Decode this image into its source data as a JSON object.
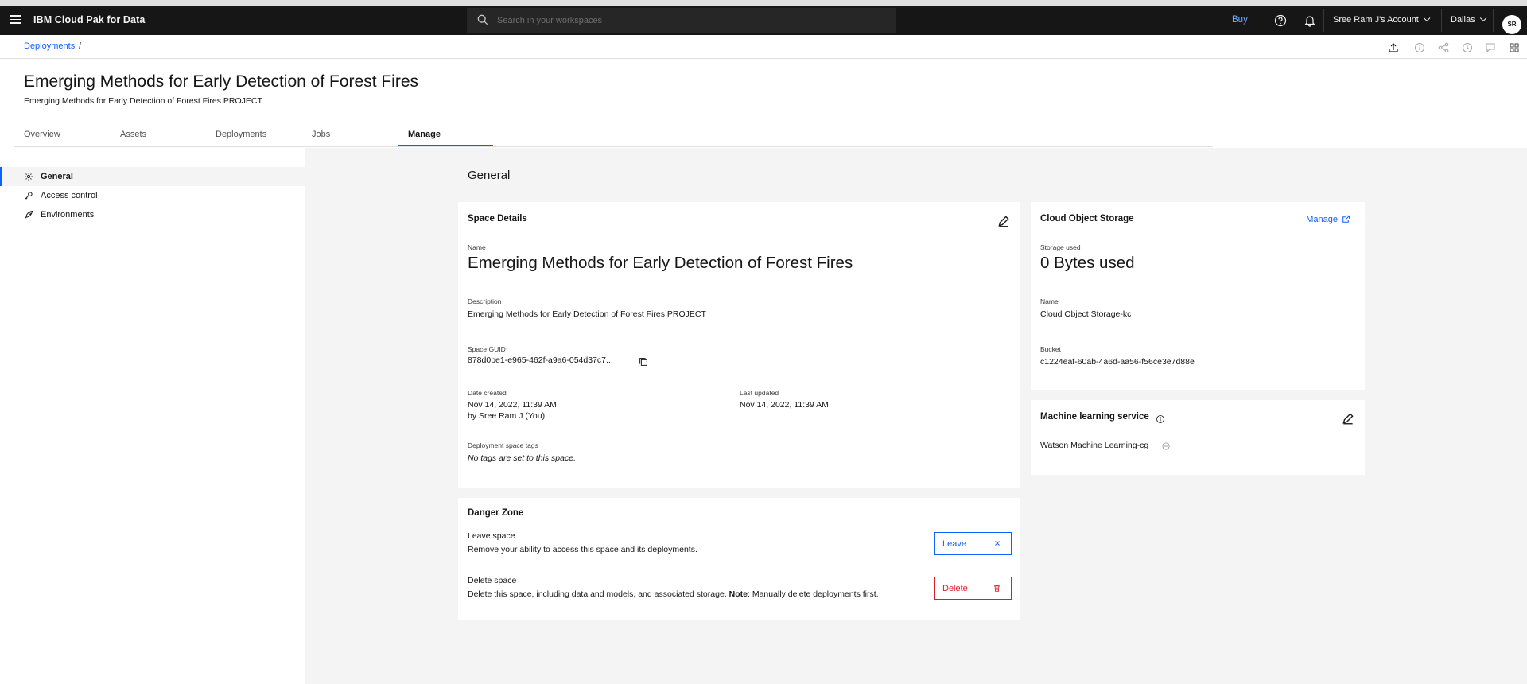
{
  "header": {
    "brand": "IBM Cloud Pak for Data",
    "search_placeholder": "Search in your workspaces",
    "buy_label": "Buy",
    "account_label": "Sree Ram J's Account",
    "region_label": "Dallas",
    "avatar_initials": "SR"
  },
  "breadcrumb": {
    "items": [
      {
        "label": "Deployments"
      }
    ],
    "separator": "/"
  },
  "page": {
    "title": "Emerging Methods for Early Detection of Forest Fires",
    "subtitle": "Emerging Methods for Early Detection of Forest Fires PROJECT"
  },
  "tabs": [
    {
      "label": "Overview",
      "active": false
    },
    {
      "label": "Assets",
      "active": false
    },
    {
      "label": "Deployments",
      "active": false
    },
    {
      "label": "Jobs",
      "active": false
    },
    {
      "label": "Manage",
      "active": true
    }
  ],
  "sidenav": {
    "items": [
      {
        "label": "General",
        "icon": "gear-icon",
        "active": true
      },
      {
        "label": "Access control",
        "icon": "key-icon",
        "active": false
      },
      {
        "label": "Environments",
        "icon": "rocket-icon",
        "active": false
      }
    ]
  },
  "main": {
    "section_title": "General",
    "space_details": {
      "title": "Space Details",
      "name_label": "Name",
      "name_value": "Emerging Methods for Early Detection of Forest Fires",
      "description_label": "Description",
      "description_value": "Emerging Methods for Early Detection of Forest Fires PROJECT",
      "guid_label": "Space GUID",
      "guid_value": "878d0be1-e965-462f-a9a6-054d37c7...",
      "date_created_label": "Date created",
      "date_created_value": "Nov 14, 2022, 11:39 AM",
      "created_by": "by Sree Ram J (You)",
      "last_updated_label": "Last updated",
      "last_updated_value": "Nov 14, 2022, 11:39 AM",
      "tags_label": "Deployment space tags",
      "tags_value": "No tags are set to this space."
    },
    "danger_zone": {
      "title": "Danger Zone",
      "leave_title": "Leave space",
      "leave_desc": "Remove your ability to access this space and its deployments.",
      "leave_button": "Leave",
      "delete_title": "Delete space",
      "delete_desc_prefix": "Delete this space, including data and models, and associated storage.",
      "delete_note_label": "Note",
      "delete_note_text": ": Manually delete deployments first.",
      "delete_button": "Delete"
    },
    "cos": {
      "title": "Cloud Object Storage",
      "manage_link": "Manage",
      "storage_label": "Storage used",
      "storage_value": "0 Bytes used",
      "name_label": "Name",
      "name_value": "Cloud Object Storage-kc",
      "bucket_label": "Bucket",
      "bucket_value": "c1224eaf-60ab-4a6d-aa56-f56ce3e7d88e"
    },
    "ml_service": {
      "title": "Machine learning service",
      "value": "Watson Machine Learning-cg"
    }
  },
  "colors": {
    "accent": "#0f62fe",
    "danger": "#da1e28",
    "header_bg": "#161616",
    "content_bg": "#f4f4f4"
  }
}
